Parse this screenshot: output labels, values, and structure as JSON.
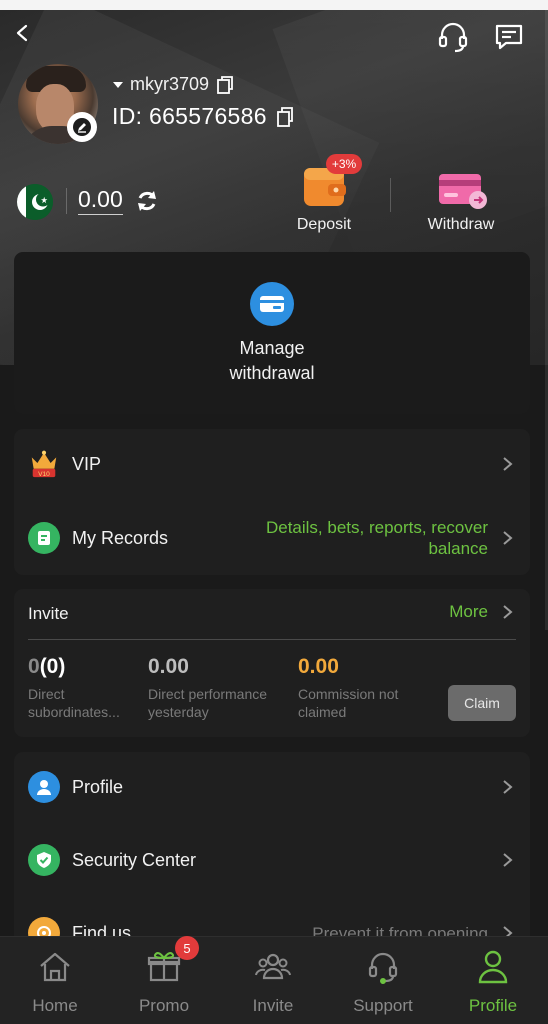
{
  "header": {
    "username": "mkyr3709",
    "user_id": "ID: 665576586"
  },
  "wallet": {
    "balance": "0.00",
    "deposit_label": "Deposit",
    "deposit_bonus": "+3%",
    "withdraw_label": "Withdraw"
  },
  "manage_withdrawal": {
    "line1": "Manage",
    "line2": "withdrawal"
  },
  "menu_top": [
    {
      "label": "VIP",
      "badge": "V10",
      "desc": ""
    },
    {
      "label": "My Records",
      "desc": "Details, bets, reports, recover balance"
    }
  ],
  "invite": {
    "title": "Invite",
    "more": "More",
    "stats": [
      {
        "value": "0(0)",
        "label": "Direct subordinates..."
      },
      {
        "value": "0.00",
        "label": "Direct performance yesterday"
      },
      {
        "value": "0.00",
        "label": "Commission not claimed"
      }
    ],
    "claim": "Claim"
  },
  "menu_bottom": [
    {
      "label": "Profile",
      "desc": ""
    },
    {
      "label": "Security Center",
      "desc": ""
    },
    {
      "label": "Find us",
      "desc": "Prevent it from opening"
    }
  ],
  "nav": {
    "items": [
      {
        "label": "Home"
      },
      {
        "label": "Promo",
        "badge": "5"
      },
      {
        "label": "Invite"
      },
      {
        "label": "Support"
      },
      {
        "label": "Profile"
      }
    ],
    "active": "Profile"
  },
  "colors": {
    "accent_green": "#6dc241",
    "commission_gold": "#f2a93b",
    "badge_red": "#e23b3b",
    "background": "#1a1a1a"
  }
}
